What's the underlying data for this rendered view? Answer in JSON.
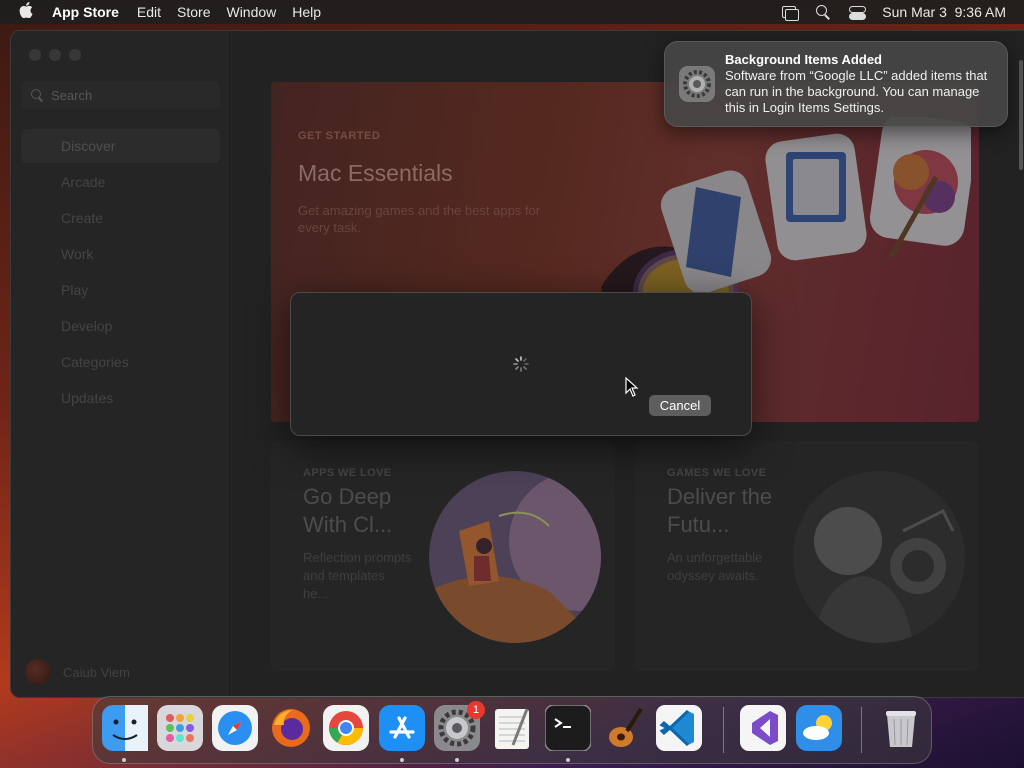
{
  "menubar": {
    "apple_icon": "apple-logo-icon",
    "app_name": "App Store",
    "menus": [
      "Edit",
      "Store",
      "Window",
      "Help"
    ],
    "datetime": "Sun Mar 3  9:36 AM",
    "icons": [
      "screen-mirroring-icon",
      "spotlight-search-icon",
      "control-center-icon"
    ]
  },
  "sidebar": {
    "search_placeholder": "Search",
    "items": [
      {
        "label": "Discover",
        "active": true
      },
      {
        "label": "Arcade"
      },
      {
        "label": "Create"
      },
      {
        "label": "Work"
      },
      {
        "label": "Play"
      },
      {
        "label": "Develop"
      },
      {
        "label": "Categories"
      },
      {
        "label": "Updates"
      }
    ],
    "user_name": "Caiub Viem"
  },
  "hero": {
    "eyebrow": "GET STARTED",
    "title": "Mac Essentials",
    "subtitle": "Get amazing games and the best apps for every task."
  },
  "cards": [
    {
      "eyebrow": "APPS WE LOVE",
      "title": "Go Deep With Cl...",
      "description": "Reflection prompts and templates he..."
    },
    {
      "eyebrow": "GAMES WE LOVE",
      "title": "Deliver the Futu...",
      "description": "An unforgettable odyssey awaits."
    }
  ],
  "sheet": {
    "cancel_label": "Cancel",
    "spinner": "loading-spinner-icon"
  },
  "notification": {
    "title": "Background Items Added",
    "body": "Software from “Google LLC” added items that can run in the background. You can manage this in Login Items Settings.",
    "icon": "system-settings-gear-icon"
  },
  "dock": {
    "apps": [
      "Finder",
      "Launchpad",
      "Safari",
      "Firefox",
      "Chrome",
      "App Store",
      "System Settings",
      "TextEdit",
      "Terminal",
      "GarageBand",
      "Visual Studio Code",
      "Visual Studio",
      "Weather",
      "Trash"
    ],
    "settings_badge": "1"
  },
  "colors": {
    "accent_red": "#e8372d",
    "window_bg": "#2b2b2b",
    "sheet_bg": "#242424"
  }
}
